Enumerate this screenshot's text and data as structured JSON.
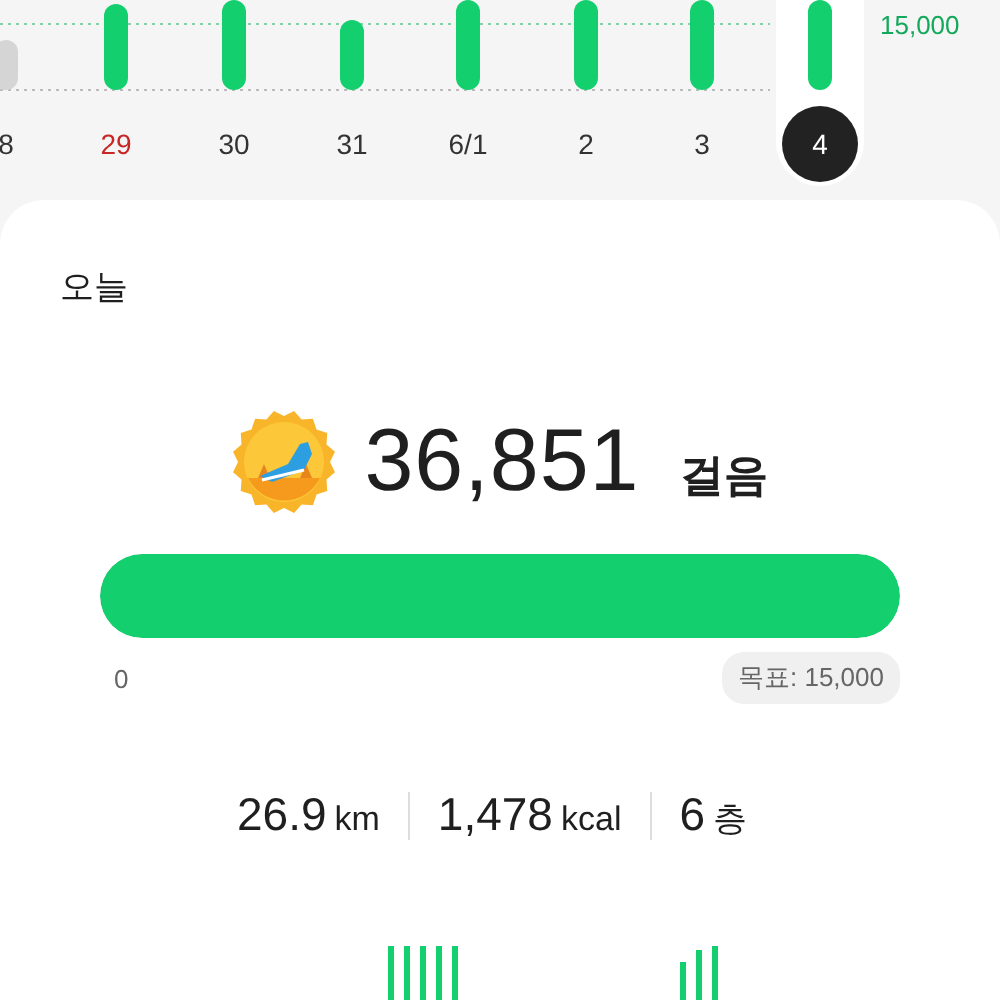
{
  "week_chart": {
    "goal_label": "15,000",
    "days": [
      {
        "label": "8",
        "selected": false,
        "holiday": false
      },
      {
        "label": "29",
        "selected": false,
        "holiday": true
      },
      {
        "label": "30",
        "selected": false,
        "holiday": false
      },
      {
        "label": "31",
        "selected": false,
        "holiday": false
      },
      {
        "label": "6/1",
        "selected": false,
        "holiday": false
      },
      {
        "label": "2",
        "selected": false,
        "holiday": false
      },
      {
        "label": "3",
        "selected": false,
        "holiday": false
      },
      {
        "label": "4",
        "selected": true,
        "holiday": false
      }
    ]
  },
  "today": {
    "title": "오늘",
    "steps": "36,851",
    "steps_unit": "걸음",
    "level": 1,
    "start_label": "0",
    "goal_label": "목표: 15,000",
    "stats": [
      {
        "value": "26.9",
        "unit": "km"
      },
      {
        "value": "1,478",
        "unit": "kcal"
      },
      {
        "value": "6",
        "unit": "층"
      }
    ]
  }
}
